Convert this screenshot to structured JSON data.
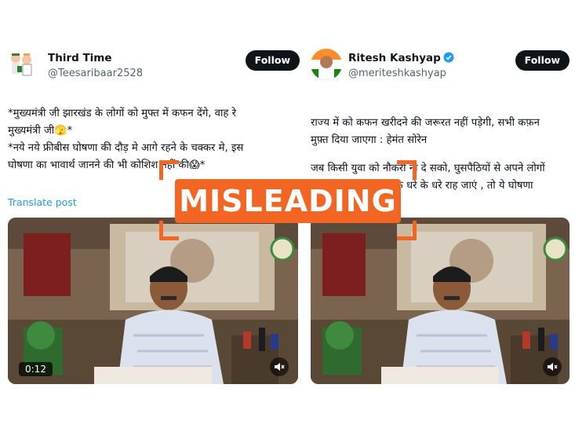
{
  "posts": [
    {
      "display_name": "Third Time",
      "handle": "@Teesaribaar2528",
      "verified": false,
      "follow_label": "Follow",
      "text_lines": [
        "*मुख्यमंत्री जी झारखंड के लोगों को मुफ्त में कफन देंगे, वाह रे",
        "मुख्यमंत्री जी🫣*",
        "*नये नये फ्रीबीस घोषणा की दौड़ मे आगे रहने के चक्कर मे, इस",
        "घोषणा का भावार्थ जानने की भी कोशिश नहीं की😱*"
      ],
      "translate_label": "Translate post",
      "video_duration": "0:12"
    },
    {
      "display_name": "Ritesh Kashyap",
      "handle": "@meriteshkashyap",
      "verified": true,
      "follow_label": "Follow",
      "text_lines": [
        "राज्य में को कफन खरीदने की जरूरत नहीं पड़ेगी, सभी कफ़न",
        "मुफ़्त दिया जाएगा : हेमंत सोरेन",
        "जब किसी युवा को नौकरी ना दे सको, घुसपैठियों से अपने लोगों",
        "को बचा ना सको, सब के धरे के धरे राह जाएं , तो ये घोषणा"
      ]
    }
  ],
  "fact_check_label": "MISLEADING",
  "colors": {
    "label_orange": "#f26522",
    "verified_blue": "#1d9bf0",
    "translate_blue": "#1d9bf0",
    "follow_bg": "#0f1419"
  },
  "icons": {
    "mute": "speaker-muted-icon",
    "verified": "verified-badge-icon"
  }
}
